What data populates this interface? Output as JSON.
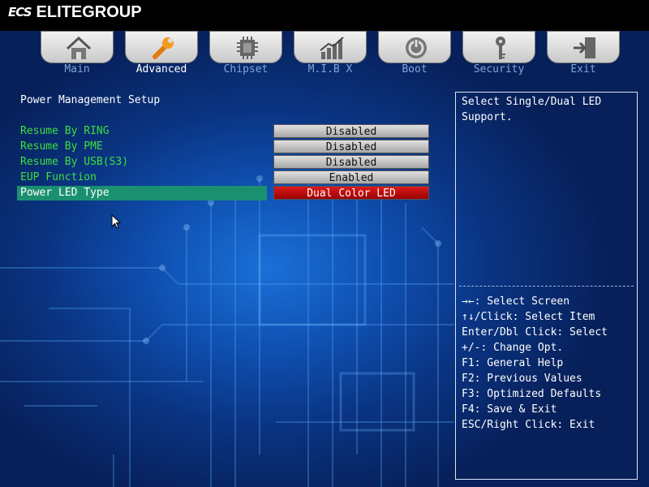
{
  "brand": {
    "logo": "ECS",
    "name": "ELITEGROUP"
  },
  "tabs": [
    {
      "label": "Main",
      "icon": "home-icon",
      "active": false
    },
    {
      "label": "Advanced",
      "icon": "wrench-icon",
      "active": true
    },
    {
      "label": "Chipset",
      "icon": "chip-icon",
      "active": false
    },
    {
      "label": "M.I.B X",
      "icon": "chart-icon",
      "active": false
    },
    {
      "label": "Boot",
      "icon": "power-icon",
      "active": false
    },
    {
      "label": "Security",
      "icon": "key-icon",
      "active": false
    },
    {
      "label": "Exit",
      "icon": "exit-door-icon",
      "active": false
    }
  ],
  "page": {
    "title": "Power Management Setup"
  },
  "settings": [
    {
      "label": "Resume By RING",
      "value": "Disabled",
      "selected": false
    },
    {
      "label": "Resume By PME",
      "value": "Disabled",
      "selected": false
    },
    {
      "label": "Resume By USB(S3)",
      "value": "Disabled",
      "selected": false
    },
    {
      "label": "EUP Function",
      "value": "Enabled",
      "selected": false
    },
    {
      "label": "Power LED Type",
      "value": "Dual Color LED",
      "selected": true
    }
  ],
  "help": {
    "description": "Select Single/Dual LED\nSupport.",
    "keys": [
      "→←: Select Screen",
      "↑↓/Click: Select Item",
      "Enter/Dbl Click: Select",
      "+/-: Change Opt.",
      "F1: General Help",
      "F2: Previous Values",
      "F3: Optimized Defaults",
      "F4: Save & Exit",
      "ESC/Right Click: Exit"
    ]
  },
  "colors": {
    "label_green": "#3de03d",
    "selected_row": "#1a9070",
    "selected_value": "#cc0000",
    "inactive_tab_label": "#7fa7d8",
    "top_bar": "#000000"
  }
}
